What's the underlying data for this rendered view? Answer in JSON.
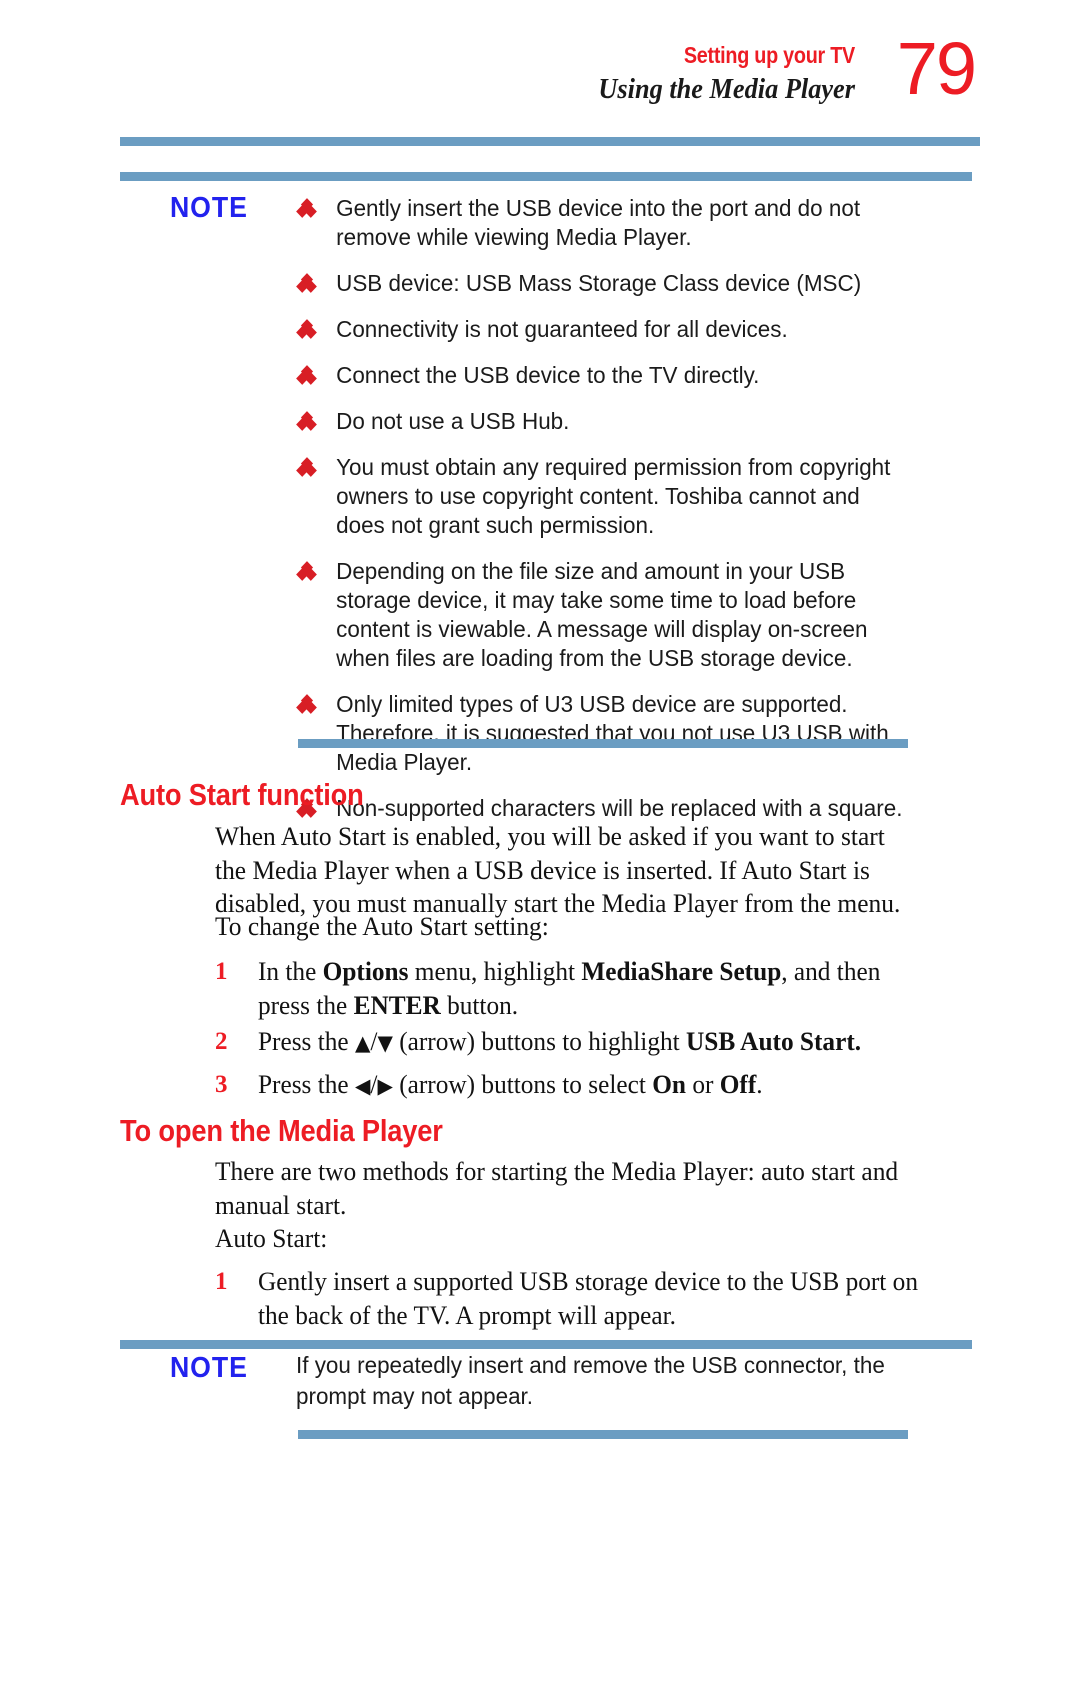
{
  "header": {
    "title": "Setting up your TV",
    "subtitle": "Using the Media Player",
    "page_number": "79",
    "rule_color": "#6b9dc2",
    "title_color": "#ed1c24"
  },
  "note_top": {
    "label": "NOTE",
    "label_color": "#2222ee",
    "bullet_color": "#d81e25",
    "bullets": [
      "Gently insert the USB device into the port and do not remove while viewing Media Player.",
      "USB device: USB Mass Storage Class device (MSC)",
      "Connectivity is not guaranteed for all devices.",
      "Connect the USB device to the TV directly.",
      "Do not use a USB Hub.",
      "You must obtain any required permission from copyright owners to use copyright content. Toshiba cannot and does not grant such permission.",
      "Depending on the file size and amount in your USB storage device, it may take some time to load before content is viewable. A message will display on-screen when files are loading from the USB storage device.",
      "Only limited types of U3 USB device are supported. Therefore, it is suggested that you not use U3 USB with Media Player.",
      "Non-supported characters will be replaced with a square."
    ]
  },
  "section_auto_start": {
    "heading": "Auto Start function",
    "heading_color": "#ed1c24",
    "paragraph": "When Auto Start is enabled, you will be asked if you want to start the Media Player when a USB device is inserted. If Auto Start is disabled, you must manually start the Media Player from the menu.",
    "lead_in": "To change the Auto Start setting:",
    "steps": [
      {
        "num": "1",
        "text_parts": [
          "In the ",
          "Options",
          " menu, highlight ",
          "MediaShare Setup",
          ", and then press the ",
          "ENTER",
          " button."
        ]
      },
      {
        "num": "2",
        "text_parts": [
          "Press the ",
          "▲",
          "/",
          "▼",
          " (arrow) buttons to highlight ",
          "USB Auto Start."
        ]
      },
      {
        "num": "3",
        "text_parts": [
          "Press the ",
          "◀",
          "/",
          "▶",
          " (arrow) buttons to select ",
          "On",
          " or ",
          "Off",
          "."
        ]
      }
    ]
  },
  "section_open_player": {
    "heading": "To open the Media Player",
    "heading_color": "#ed1c24",
    "paragraph": "There are two methods for starting the Media Player: auto start and manual start.",
    "lead_in": "Auto Start:",
    "steps": [
      {
        "num": "1",
        "text": "Gently insert a supported USB storage device to the USB port on the back of the TV. A prompt will appear."
      }
    ]
  },
  "note_bottom": {
    "label": "NOTE",
    "label_color": "#2222ee",
    "text": "If you repeatedly insert and remove the USB connector, the prompt may not appear."
  }
}
